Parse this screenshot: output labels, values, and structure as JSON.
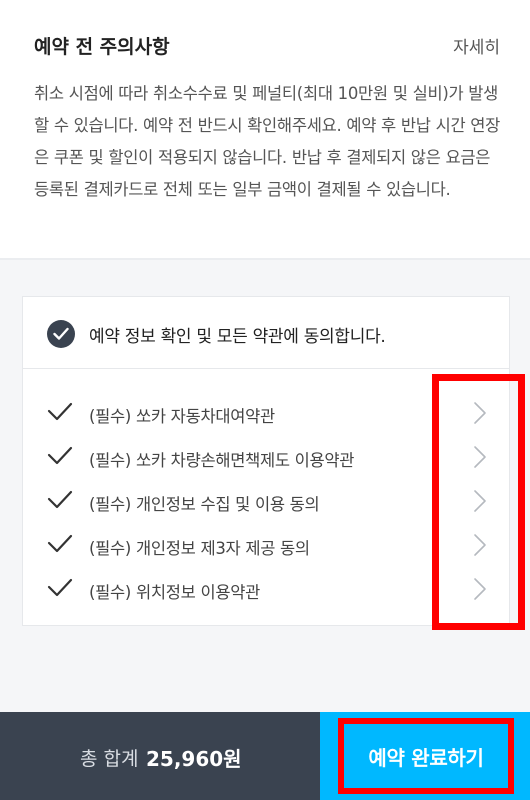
{
  "notice": {
    "title": "예약 전 주의사항",
    "more_label": "자세히",
    "body": "취소 시점에 따라 취소수수료 및 페널티(최대 10만원 및 실비)가 발생할 수 있습니다. 예약 전 반드시 확인해주세요. 예약 후 반납 시간 연장은 쿠폰 및 할인이 적용되지 않습니다. 반납 후 결제되지 않은 요금은 등록된 결제카드로 전체 또는 일부 금액이 결제될 수 있습니다."
  },
  "terms": {
    "agree_all_label": "예약 정보 확인 및 모든 약관에 동의합니다.",
    "agree_all_checked": true,
    "items": [
      {
        "label": "(필수) 쏘카 자동차대여약관",
        "checked": true
      },
      {
        "label": "(필수) 쏘카 차량손해면책제도 이용약관",
        "checked": true
      },
      {
        "label": "(필수) 개인정보 수집 및 이용 동의",
        "checked": true
      },
      {
        "label": "(필수) 개인정보 제3자 제공 동의",
        "checked": true
      },
      {
        "label": "(필수) 위치정보 이용약관",
        "checked": true
      }
    ]
  },
  "footer": {
    "total_label": "총 합계",
    "total_amount": "25,960원",
    "confirm_label": "예약 완료하기"
  },
  "colors": {
    "confirm_bg": "#00b8ff",
    "footer_bg": "#3a4350",
    "highlight": "#ff0000"
  },
  "icons": {
    "check": "check-icon",
    "chevron": "chevron-right-icon"
  }
}
